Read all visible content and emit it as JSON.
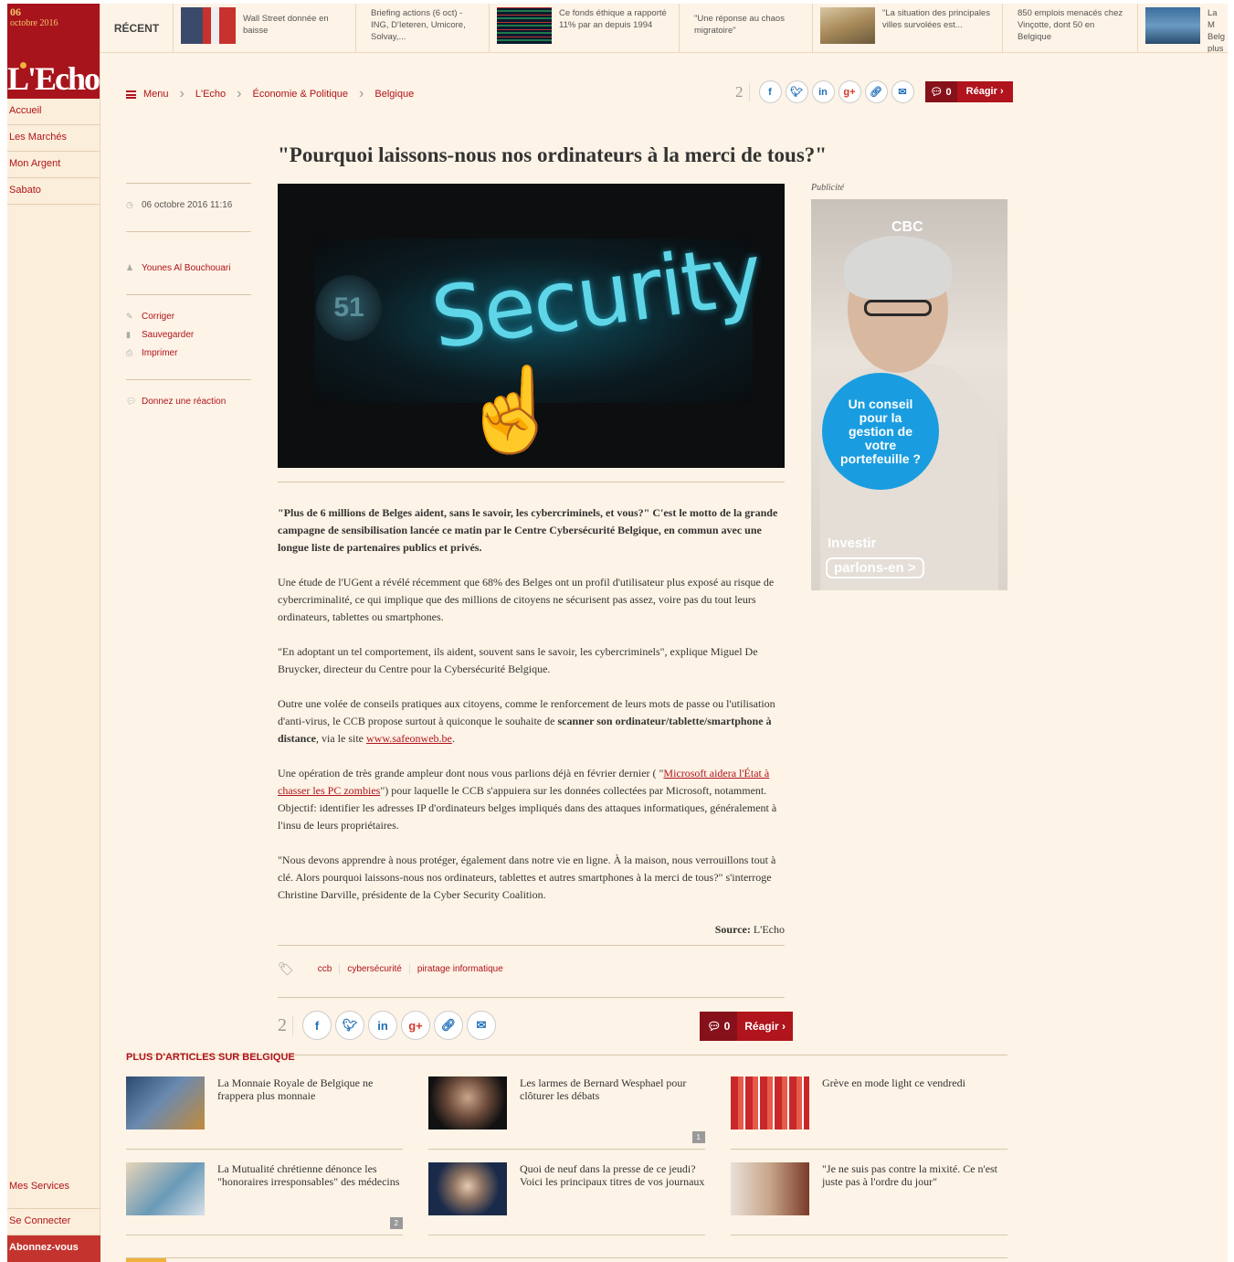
{
  "brand": {
    "day": "06",
    "month": "octobre 2016",
    "logo": "L'Echo"
  },
  "sidebar": {
    "items": [
      {
        "label": "Accueil"
      },
      {
        "label": "Les Marchés"
      },
      {
        "label": "Mon Argent"
      },
      {
        "label": "Sabato"
      }
    ],
    "bottom": [
      {
        "label": "Mes Services"
      },
      {
        "label": "Se Connecter"
      },
      {
        "label": "Abonnez-vous"
      }
    ]
  },
  "recent": {
    "label": "RÉCENT",
    "items": [
      {
        "text": "Wall Street donnée en baisse"
      },
      {
        "text": "Briefing actions (6 oct) - ING, D'Ieteren, Umicore, Solvay,..."
      },
      {
        "text": "Ce fonds éthique a rapporté 11% par an depuis 1994"
      },
      {
        "text": "\"Une réponse au chaos migratoire\""
      },
      {
        "text": "\"La situation des principales villes survolées est..."
      },
      {
        "text": "850 emplois menacés chez Vinçotte, dont 50 en Belgique"
      },
      {
        "text": "La M Belg plus"
      }
    ]
  },
  "breadcrumb": {
    "menu": "Menu",
    "items": [
      "L'Echo",
      "Économie & Politique",
      "Belgique"
    ]
  },
  "share": {
    "count": "2",
    "buttons": [
      "f",
      "t",
      "in",
      "g+",
      "link",
      "mail"
    ],
    "comments": "0",
    "react_label": "Réagir"
  },
  "article": {
    "title": "\"Pourquoi laissons-nous nos ordinateurs à la merci de tous?\"",
    "date": "06 octobre 2016 11:16",
    "author": "Younes Al Bouchouari",
    "actions": [
      "Corriger",
      "Sauvegarder",
      "Imprimer"
    ],
    "reaction": "Donnez une réaction",
    "hero_word": "Security",
    "lead": "\"Plus de 6 millions de Belges aident, sans le savoir, les cybercriminels, et vous?\" C'est le motto de la grande campagne de sensibilisation lancée ce matin par le Centre Cybersécurité Belgique, en commun avec une longue liste de partenaires publics et privés.",
    "p1": "Une étude de l'UGent a révélé récemment que 68% des Belges ont un profil d'utilisateur plus exposé au risque de cybercriminalité, ce qui implique que des millions de citoyens ne sécurisent pas assez, voire pas du tout leurs ordinateurs, tablettes ou smartphones.",
    "p2": "\"En adoptant un tel comportement, ils aident, souvent sans le savoir, les cybercriminels\", explique Miguel De Bruycker, directeur du Centre pour la Cybersécurité Belgique.",
    "p3_a": "Outre une volée de conseils pratiques aux citoyens, comme le renforcement de leurs mots de passe ou l'utilisation d'anti-virus, le CCB propose surtout à quiconque le souhaite de ",
    "p3_b": "scanner son ordinateur/tablette/smartphone à distance",
    "p3_c": ", via le site ",
    "p3_link": "www.safeonweb.be",
    "p3_d": ".",
    "p4_a": "Une opération de très grande ampleur dont nous vous parlions déjà en février dernier ( \"",
    "p4_link": "Microsoft aidera l'État à chasser les PC zombies",
    "p4_b": "\") pour laquelle le CCB s'appuiera sur les données collectées par Microsoft, notamment. Objectif: identifier les adresses IP d'ordinateurs belges impliqués dans des attaques informatiques, généralement à l'insu de leurs propriétaires.",
    "p5": "\"Nous devons apprendre à nous protéger, également dans notre vie en ligne. À la maison, nous verrouillons tout à clé. Alors pourquoi laissons-nous nos ordinateurs, tablettes et autres smartphones à la merci de tous?\" s'interroge Christine Darville, présidente de la Cyber Security Coalition.",
    "source_label": "Source:",
    "source_value": "L'Echo",
    "tags": [
      "ccb",
      "cybersécurité",
      "piratage informatique"
    ]
  },
  "ad": {
    "label": "Publicité",
    "brand": "CBC",
    "bubble": "Un conseil pour la gestion de votre portefeuille ?",
    "invest": "Investir",
    "cta": "parlons-en >"
  },
  "related": {
    "heading": "PLUS D'ARTICLES SUR BELGIQUE",
    "items": [
      {
        "title": "La Monnaie Royale de Belgique ne frappera plus monnaie",
        "badge": ""
      },
      {
        "title": "Les larmes de Bernard Wesphael pour clôturer les débats",
        "badge": "1"
      },
      {
        "title": "Grève en mode light ce vendredi",
        "badge": ""
      },
      {
        "title": "La Mutualité chrétienne dénonce les \"honoraires irresponsables\" des médecins",
        "badge": "2"
      },
      {
        "title": "Quoi de neuf dans la presse de ce jeudi? Voici les principaux titres de vos journaux",
        "badge": ""
      },
      {
        "title": "\"Je ne suis pas contre la mixité. Ce n'est juste pas à l'ordre du jour\"",
        "badge": ""
      }
    ]
  },
  "colors": {
    "brand_red": "#b0141c",
    "page_bg": "#fdf3e6"
  }
}
